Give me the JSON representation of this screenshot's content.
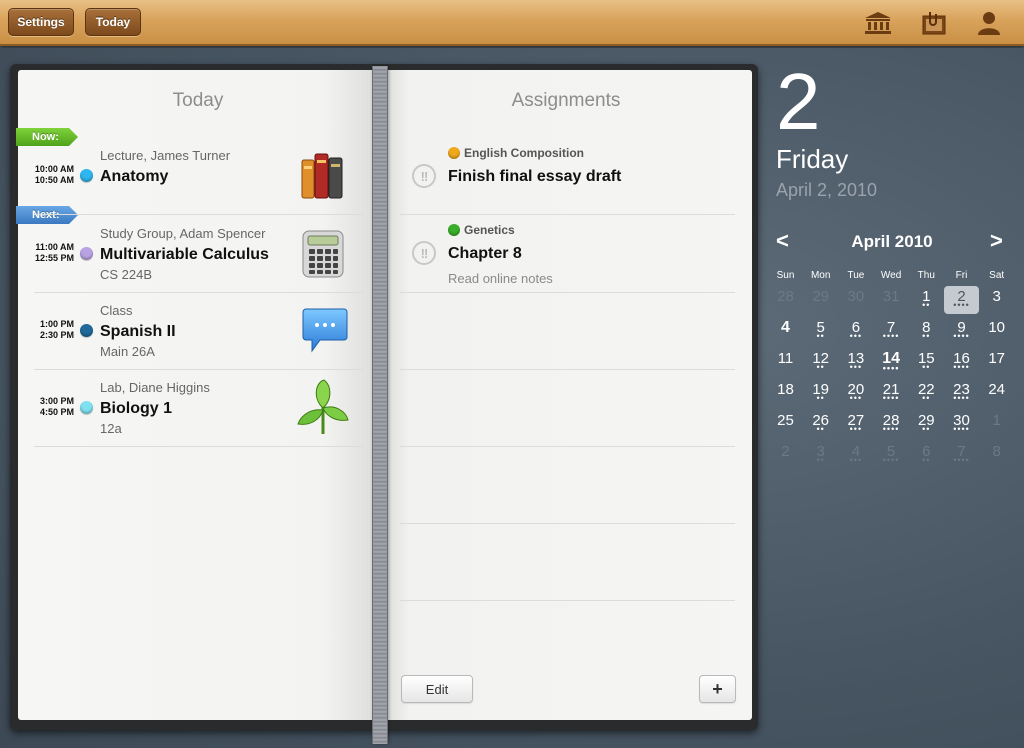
{
  "toolbar": {
    "settings_label": "Settings",
    "today_label": "Today",
    "icons": [
      "school-icon",
      "assignment-clip-icon",
      "profile-icon"
    ]
  },
  "left_page": {
    "title": "Today",
    "now_tag": "Now:",
    "next_tag": "Next:",
    "classes": [
      {
        "start": "10:00 AM",
        "end": "10:50 AM",
        "subtitle": "Lecture, James Turner",
        "title": "Anatomy",
        "room": "",
        "color": "#2db6ef",
        "icon": "books-icon"
      },
      {
        "start": "11:00 AM",
        "end": "12:55 PM",
        "subtitle": "Study Group, Adam Spencer",
        "title": "Multivariable Calculus",
        "room": "CS 224B",
        "color": "#b9a3e3",
        "icon": "calculator-icon"
      },
      {
        "start": "1:00 PM",
        "end": "2:30 PM",
        "subtitle": "Class",
        "title": "Spanish II",
        "room": "Main 26A",
        "color": "#1f6a9a",
        "icon": "chat-bubble-icon"
      },
      {
        "start": "3:00 PM",
        "end": "4:50 PM",
        "subtitle": "Lab, Diane Higgins",
        "title": "Biology 1",
        "room": "12a",
        "color": "#7fe0f0",
        "icon": "plant-icon"
      }
    ]
  },
  "right_page": {
    "title": "Assignments",
    "assignments": [
      {
        "course": "English Composition",
        "course_color": "#f0a81c",
        "title": "Finish final essay draft",
        "note": "",
        "priority": "!!"
      },
      {
        "course": "Genetics",
        "course_color": "#3aae2a",
        "title": "Chapter 8",
        "note": "Read online notes",
        "priority": "!!"
      }
    ],
    "edit_label": "Edit",
    "add_label": "+"
  },
  "date_panel": {
    "day_number": "2",
    "weekday": "Friday",
    "full_date": "April 2, 2010"
  },
  "calendar": {
    "month_title": "April 2010",
    "prev": "<",
    "next": ">",
    "weekdays": [
      "Sun",
      "Mon",
      "Tue",
      "Wed",
      "Thu",
      "Fri",
      "Sat"
    ],
    "weeks": [
      [
        {
          "d": "28",
          "out": true,
          "dots": 0
        },
        {
          "d": "29",
          "out": true,
          "dots": 0
        },
        {
          "d": "30",
          "out": true,
          "dots": 0
        },
        {
          "d": "31",
          "out": true,
          "dots": 0
        },
        {
          "d": "1",
          "dots": 2
        },
        {
          "d": "2",
          "sel": true,
          "dots": 4
        },
        {
          "d": "3",
          "dots": 0
        }
      ],
      [
        {
          "d": "4",
          "bold": true,
          "dots": 0
        },
        {
          "d": "5",
          "dots": 2
        },
        {
          "d": "6",
          "dots": 3
        },
        {
          "d": "7",
          "dots": 4
        },
        {
          "d": "8",
          "dots": 2
        },
        {
          "d": "9",
          "dots": 4
        },
        {
          "d": "10",
          "dots": 0
        }
      ],
      [
        {
          "d": "11",
          "dots": 0
        },
        {
          "d": "12",
          "dots": 2
        },
        {
          "d": "13",
          "dots": 3
        },
        {
          "d": "14",
          "bold": true,
          "dots": 4
        },
        {
          "d": "15",
          "dots": 2
        },
        {
          "d": "16",
          "dots": 4
        },
        {
          "d": "17",
          "dots": 0
        }
      ],
      [
        {
          "d": "18",
          "dots": 0
        },
        {
          "d": "19",
          "dots": 2
        },
        {
          "d": "20",
          "dots": 3
        },
        {
          "d": "21",
          "dots": 4
        },
        {
          "d": "22",
          "dots": 2
        },
        {
          "d": "23",
          "dots": 4
        },
        {
          "d": "24",
          "dots": 0
        }
      ],
      [
        {
          "d": "25",
          "dots": 0
        },
        {
          "d": "26",
          "dots": 2
        },
        {
          "d": "27",
          "dots": 3
        },
        {
          "d": "28",
          "dots": 4
        },
        {
          "d": "29",
          "dots": 2
        },
        {
          "d": "30",
          "dots": 4
        },
        {
          "d": "1",
          "out": true,
          "dots": 0
        }
      ],
      [
        {
          "d": "2",
          "out": true,
          "dots": 0
        },
        {
          "d": "3",
          "out": true,
          "dots": 2
        },
        {
          "d": "4",
          "out": true,
          "dots": 3
        },
        {
          "d": "5",
          "out": true,
          "dots": 4
        },
        {
          "d": "6",
          "out": true,
          "dots": 2
        },
        {
          "d": "7",
          "out": true,
          "dots": 4
        },
        {
          "d": "8",
          "out": true,
          "dots": 0
        }
      ]
    ]
  }
}
